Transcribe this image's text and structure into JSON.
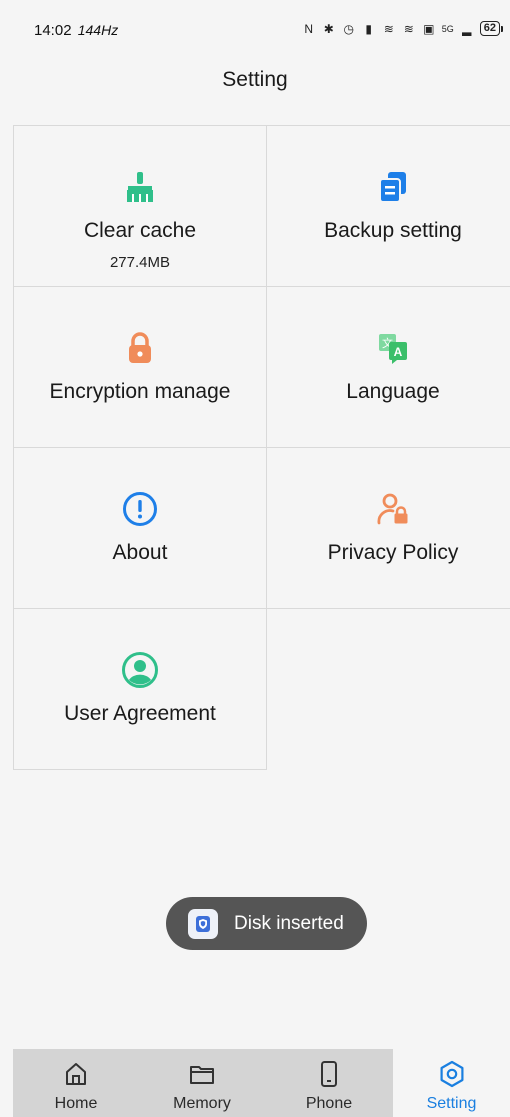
{
  "status_bar": {
    "time": "14:02",
    "refresh_rate": "144Hz",
    "network": "5G",
    "battery": "62"
  },
  "header": {
    "title": "Setting"
  },
  "settings": {
    "items": [
      {
        "label": "Clear cache",
        "sub": "277.4MB",
        "icon": "broom-icon",
        "color": "#2fbf8a"
      },
      {
        "label": "Backup setting",
        "sub": "",
        "icon": "copy-icon",
        "color": "#1e7fe8"
      },
      {
        "label": "Encryption manage",
        "sub": "",
        "icon": "lock-icon",
        "color": "#f08c5a"
      },
      {
        "label": "Language",
        "sub": "",
        "icon": "translate-icon",
        "color": "#3bbf6a"
      },
      {
        "label": "About",
        "sub": "",
        "icon": "info-icon",
        "color": "#1e7fe8"
      },
      {
        "label": "Privacy Policy",
        "sub": "",
        "icon": "user-lock-icon",
        "color": "#f08c5a"
      },
      {
        "label": "User Agreement",
        "sub": "",
        "icon": "user-circle-icon",
        "color": "#2fbf8a"
      }
    ]
  },
  "toast": {
    "text": "Disk inserted",
    "icon": "shield-app-icon"
  },
  "bottom_nav": {
    "items": [
      {
        "label": "Home",
        "icon": "home-icon"
      },
      {
        "label": "Memory",
        "icon": "folder-icon"
      },
      {
        "label": "Phone",
        "icon": "phone-icon"
      },
      {
        "label": "Setting",
        "icon": "hexagon-settings-icon",
        "active": true
      }
    ],
    "active_color": "#1a7fe0"
  }
}
